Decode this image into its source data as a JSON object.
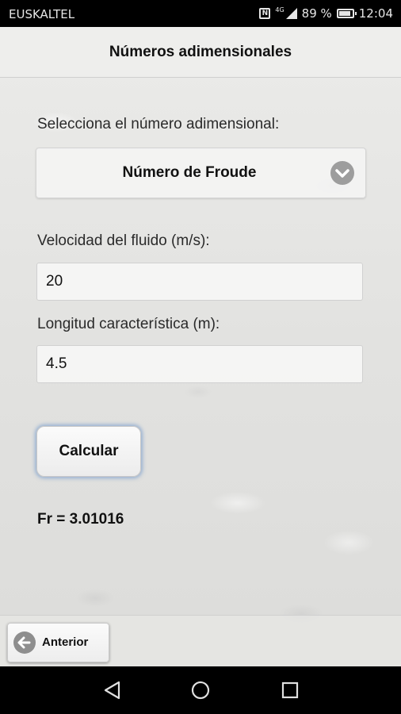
{
  "status_bar": {
    "carrier": "EUSKALTEL",
    "network_type": "4G",
    "battery_percent": "89 %",
    "time": "12:04",
    "icons": [
      "nfc-icon",
      "signal-icon",
      "battery-icon"
    ]
  },
  "header": {
    "title": "Números adimensionales"
  },
  "form": {
    "select_label": "Selecciona el número adimensional:",
    "selected_number": "Número de Froude",
    "velocity_label": "Velocidad del fluido (m/s):",
    "velocity_value": "20",
    "length_label": "Longitud característica (m):",
    "length_value": "4.5",
    "calculate_label": "Calcular"
  },
  "result": {
    "text": "Fr = 3.01016"
  },
  "footer": {
    "previous_label": "Anterior"
  },
  "nav_bar": {
    "icons": [
      "back-icon",
      "home-icon",
      "recents-icon"
    ]
  },
  "colors": {
    "accent_glow": "#5b8ac8",
    "icon_gray": "#9d9d9d"
  }
}
